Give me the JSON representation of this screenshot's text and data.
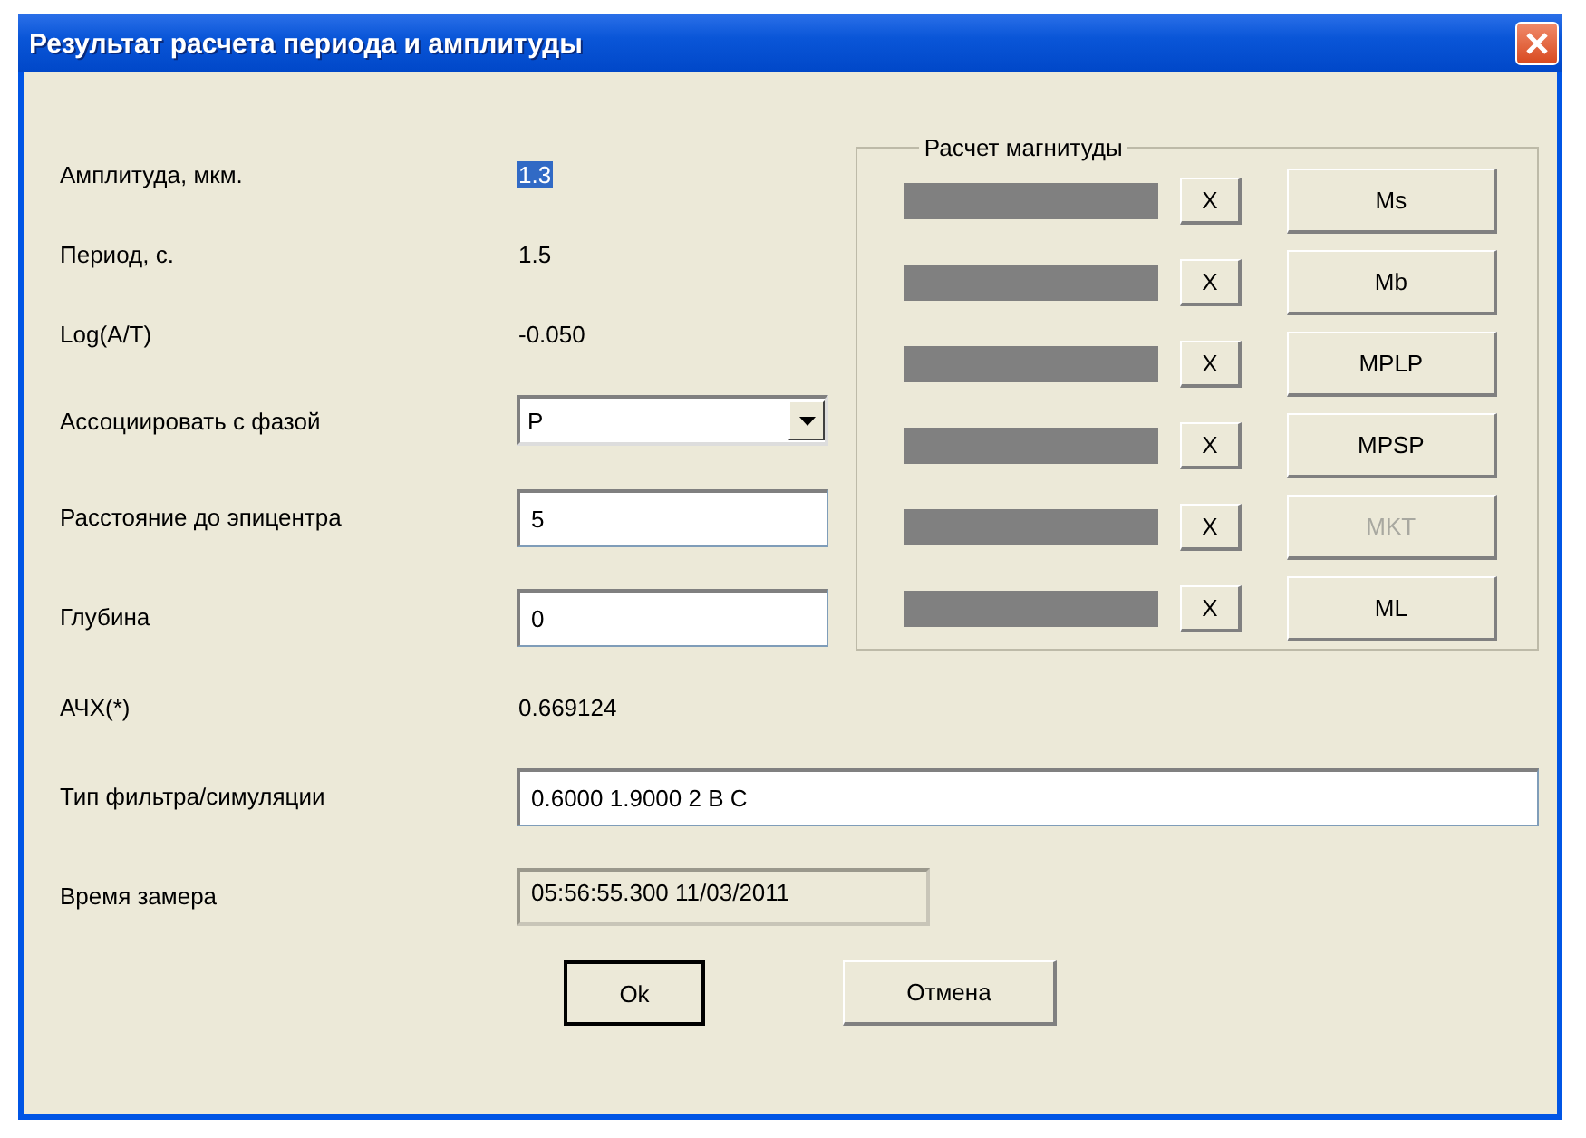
{
  "window": {
    "title": "Результат расчета периода и амплитуды"
  },
  "fields": [
    {
      "label": "Амплитуда, мкм.",
      "kind": "text",
      "value": "1.3",
      "selected": true
    },
    {
      "label": "Период, с.",
      "kind": "text",
      "value": "1.5",
      "selected": false
    },
    {
      "label": "Log(A/T)",
      "kind": "text",
      "value": "-0.050",
      "selected": false
    },
    {
      "label": "Ассоциировать с фазой",
      "kind": "combo",
      "value": "P"
    },
    {
      "label": "Расстояние до эпицентра",
      "kind": "input",
      "value": "5"
    },
    {
      "label": "Глубина",
      "kind": "input",
      "value": "0"
    }
  ],
  "magnitude_group": {
    "title": "Расчет магнитуды",
    "rows": [
      {
        "clear": "X",
        "button": "Ms",
        "disabled": false
      },
      {
        "clear": "X",
        "button": "Mb",
        "disabled": false
      },
      {
        "clear": "X",
        "button": "MPLP",
        "disabled": false
      },
      {
        "clear": "X",
        "button": "MPSP",
        "disabled": false
      },
      {
        "clear": "X",
        "button": "MKT",
        "disabled": true
      },
      {
        "clear": "X",
        "button": "ML",
        "disabled": false
      }
    ]
  },
  "lower_fields": [
    {
      "label": "АЧХ(*)",
      "kind": "text",
      "value": "0.669124"
    },
    {
      "label": "Тип фильтра/симуляции",
      "kind": "wide-input",
      "value": "0.6000 1.9000 2 B C"
    },
    {
      "label": "Время замера",
      "kind": "readonly",
      "value": "05:56:55.300 11/03/2011"
    }
  ],
  "buttons": [
    {
      "label": "Ok",
      "default": true
    },
    {
      "label": "Отмена",
      "default": false
    }
  ]
}
